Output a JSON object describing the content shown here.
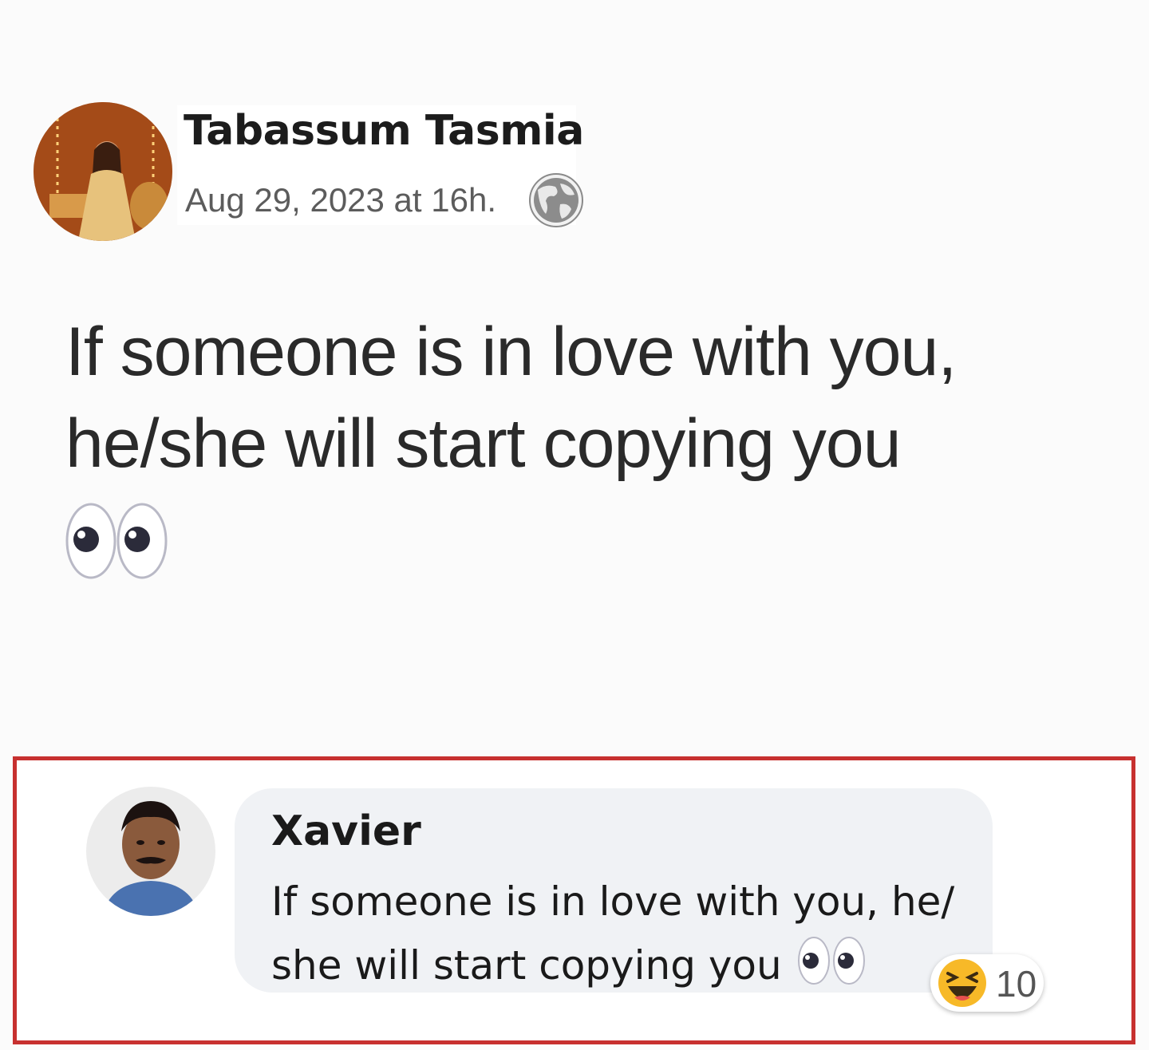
{
  "post": {
    "author_name": "Tabassum Tasmia",
    "timestamp": "Aug 29, 2023 at 16h.",
    "privacy_icon": "globe-icon",
    "text": "If someone is in love with you, he/she will start copying you",
    "emoji": "eyes-emoji"
  },
  "comment": {
    "author_name": "Xavier",
    "text": "If someone is in love with you, he/ she will start copying you",
    "emoji": "eyes-emoji",
    "reaction": {
      "icon": "haha-reaction-icon",
      "count": "10"
    },
    "highlight_color": "#c7302f"
  }
}
